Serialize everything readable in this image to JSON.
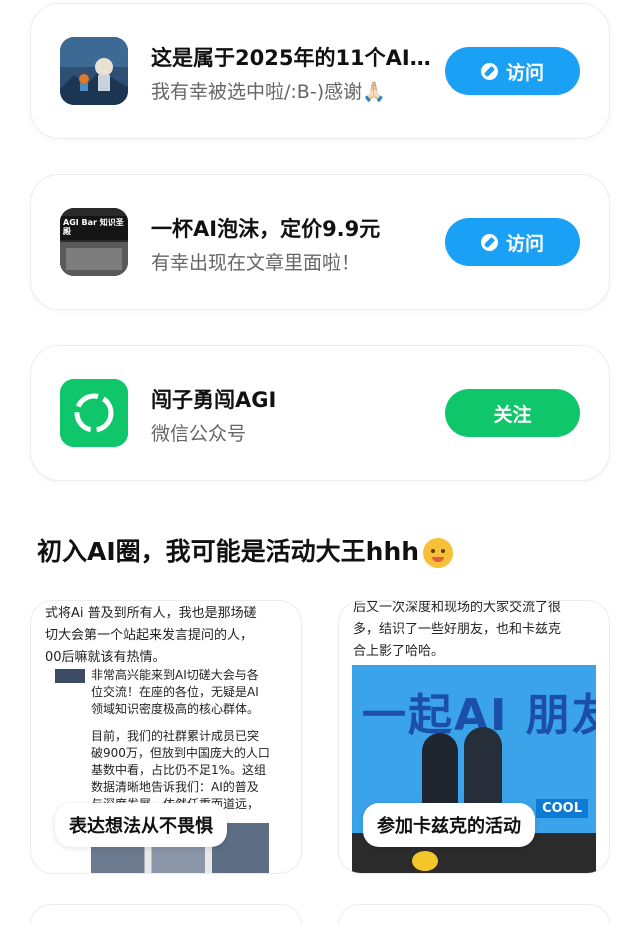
{
  "cards": [
    {
      "title": "这是属于2025年的11个AI …",
      "subtitle": "我有幸被选中啦/:B-)感谢🙏🏻",
      "button": "访问"
    },
    {
      "title": "一杯AI泡沫，定价9.9元",
      "subtitle": "有幸出现在文章里面啦！",
      "thumb_text": "AGI Bar 知识圣殿",
      "button": "访问"
    },
    {
      "title": "闯子勇闯AGI",
      "subtitle": "微信公众号",
      "button": "关注"
    }
  ],
  "section": {
    "title": "初入AI圈，我可能是活动大王hhh"
  },
  "posts": [
    {
      "lines": [
        "式将Ai 普及到所有人，我也是那场磋",
        "切大会第一个站起来发言提问的人，",
        "00后嘛就该有热情。"
      ],
      "inner": [
        "非常高兴能来到AI切磋大会与各",
        "位交流！在座的各位，无疑是AI",
        "领域知识密度极高的核心群体。",
        "目前，我们的社群累计成员已突",
        "破900万，但放到中国庞大的人口",
        "基数中看，占比仍不足1%。这组",
        "数据清晰地告诉我们：AI的普及",
        "与深度发展，依然任重而道远，"
      ],
      "tag": "表达想法从不畏惧"
    },
    {
      "lines": [
        "后又一次深度和现场的大家交流了很",
        "多，结识了一些好朋友，也和卡兹克",
        "合上影了哈哈。"
      ],
      "poster": "一起AI 朋友",
      "poster_sub": "COOL",
      "tag": "参加卡兹克的活动"
    }
  ],
  "colors": {
    "visit": "#1aa0f5",
    "follow": "#10c66a"
  }
}
